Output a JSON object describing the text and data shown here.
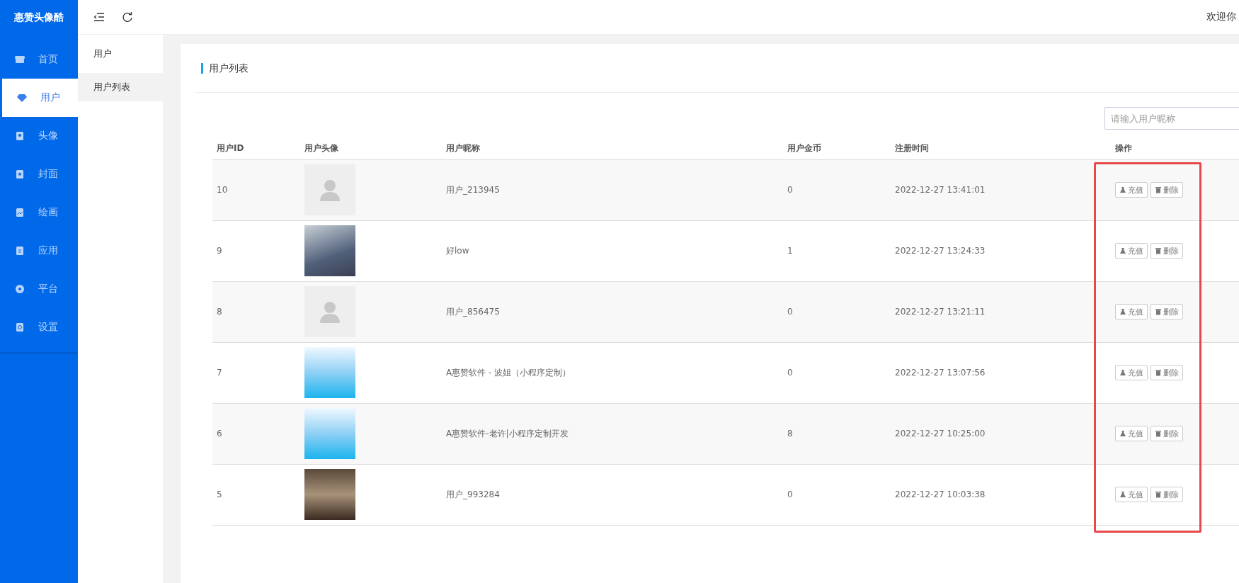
{
  "brand": "惠赞头像酷",
  "nav": [
    {
      "label": "首页",
      "selected": false
    },
    {
      "label": "用户",
      "selected": true
    },
    {
      "label": "头像",
      "selected": false
    },
    {
      "label": "封面",
      "selected": false
    },
    {
      "label": "绘画",
      "selected": false
    },
    {
      "label": "应用",
      "selected": false
    },
    {
      "label": "平台",
      "selected": false
    },
    {
      "label": "设置",
      "selected": false
    }
  ],
  "header": {
    "welcome": "欢迎你"
  },
  "subnav": {
    "title": "用户",
    "items": [
      {
        "label": "用户列表",
        "selected": true
      }
    ]
  },
  "card": {
    "title": "用户列表",
    "search": {
      "placeholder": "请输入用户昵称"
    }
  },
  "table": {
    "columns": [
      "用户ID",
      "用户头像",
      "用户昵称",
      "用户金币",
      "注册时间",
      "操作"
    ],
    "rows": [
      {
        "kind": "placeholder",
        "id": "10",
        "nickname": "用户_213945",
        "coins": "0",
        "registered": "2022-12-27 13:41:01",
        "actions": [
          "充值",
          "删除"
        ]
      },
      {
        "kind": "photo",
        "id": "9",
        "nickname": "好low",
        "coins": "1",
        "registered": "2022-12-27 13:24:33",
        "actions": [
          "充值",
          "删除"
        ]
      },
      {
        "kind": "placeholder",
        "id": "8",
        "nickname": "用户_856475",
        "coins": "0",
        "registered": "2022-12-27 13:21:11",
        "actions": [
          "充值",
          "删除"
        ]
      },
      {
        "kind": "logo",
        "id": "7",
        "nickname": "A惠赞软件 - 波姐（小程序定制）",
        "coins": "0",
        "registered": "2022-12-27 13:07:56",
        "actions": [
          "充值",
          "删除"
        ]
      },
      {
        "kind": "logo",
        "id": "6",
        "nickname": "A惠赞软件-老许|小程序定制开发",
        "coins": "8",
        "registered": "2022-12-27 10:25:00",
        "actions": [
          "充值",
          "删除"
        ]
      },
      {
        "kind": "interior",
        "id": "5",
        "nickname": "用户_993284",
        "coins": "0",
        "registered": "2022-12-27 10:03:38",
        "actions": [
          "充值",
          "删除"
        ]
      }
    ]
  },
  "annotation": {
    "kind": "frame",
    "color": "#e8474b"
  }
}
